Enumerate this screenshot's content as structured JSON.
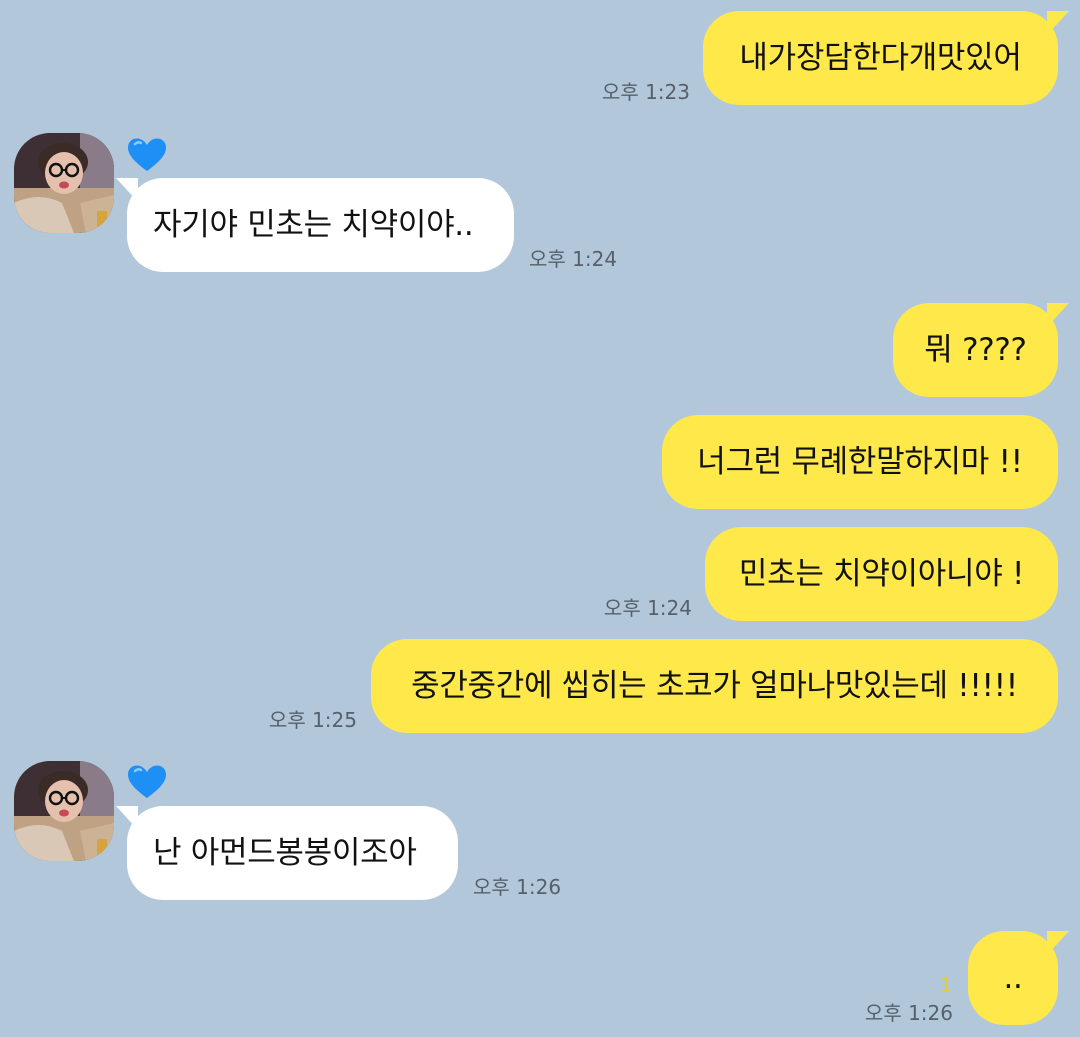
{
  "contact": {
    "status_icon": "blue-heart-icon",
    "avatar_icon": "profile-photo"
  },
  "colors": {
    "background": "#b2c7da",
    "my_bubble": "#fee84a",
    "their_bubble": "#ffffff",
    "unread": "#e7cf1e",
    "heart": "#1e8ff5"
  },
  "messages": [
    {
      "sender": "me",
      "text": "내가장담한다개맛있어",
      "time": "오후 1:23"
    },
    {
      "sender": "them",
      "text": "자기야 민초는 치약이야..",
      "time": "오후 1:24"
    },
    {
      "sender": "me",
      "text": "뭐 ????",
      "time": ""
    },
    {
      "sender": "me",
      "text": "너그런 무례한말하지마 !!",
      "time": ""
    },
    {
      "sender": "me",
      "text": "민초는 치약이아니야 !",
      "time": "오후 1:24"
    },
    {
      "sender": "me",
      "text": "중간중간에 씹히는 초코가 얼마나맛있는데 !!!!!",
      "time": "오후 1:25"
    },
    {
      "sender": "them",
      "text": "난 아먼드봉봉이조아",
      "time": "오후 1:26"
    },
    {
      "sender": "me",
      "text": "..",
      "time": "오후 1:26",
      "unread": "1"
    }
  ]
}
